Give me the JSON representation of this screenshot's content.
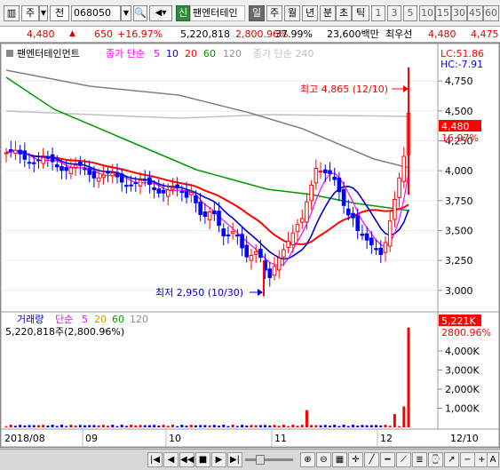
{
  "toolbar": {
    "market": "주",
    "range": "전",
    "code": "068050",
    "new_badge": "신",
    "stock_name": "팬엔터테인",
    "periods": [
      "일",
      "주",
      "월",
      "년",
      "분",
      "초",
      "틱"
    ],
    "selected_period": "일",
    "intervals": [
      "1",
      "3",
      "5",
      "10",
      "15",
      "30",
      "45",
      "60"
    ]
  },
  "price_row": {
    "price": "4,480",
    "change": "650",
    "change_pct": "+16.97%",
    "volume": "5,220,818",
    "volume_pct": "2,800.96%",
    "turnover": "37.99%",
    "amount": "23,600백만",
    "best_ask_label": "최우선",
    "ask": "4,480",
    "bid": "4,475"
  },
  "price_panel": {
    "legend_name": "팬엔터테인먼트",
    "legend_ma_label": "종가 단순",
    "ma_periods": [
      "5",
      "10",
      "20",
      "60",
      "120"
    ],
    "legend_ma240": "종가 단순 240",
    "lc": "LC:51.86",
    "hc": "HC:-7.91",
    "current_price": "4,480",
    "current_pct": "16.97%",
    "high_label": "최고 4,865 (12/10)",
    "low_label": "최저 2,950 (10/30)",
    "y_ticks": [
      "4,750",
      "4,500",
      "4,250",
      "4,000",
      "3,750",
      "3,500",
      "3,250",
      "3,000"
    ]
  },
  "volume_panel": {
    "legend_label": "거래량",
    "legend_ma_label": "단순",
    "ma_periods": [
      "5",
      "20",
      "60",
      "120"
    ],
    "value_text": "5,220,818주(2,800.96%)",
    "current_volume": "5,221K",
    "current_pct": "2800.96%",
    "y_ticks": [
      "4,000K",
      "3,000K",
      "2,000K",
      "1,000K"
    ]
  },
  "x_axis": {
    "labels": [
      "2018/08",
      "09",
      "10",
      "11",
      "12",
      "12/10"
    ]
  },
  "colors": {
    "up": "#ff0000",
    "down": "#0000ff",
    "ma5": "#ff00ff",
    "ma10": "#0000cc",
    "ma20": "#ff0000",
    "ma60": "#009900",
    "ma120": "#808080",
    "ma240": "#c0c0c0"
  },
  "chart_data": {
    "type": "candlestick",
    "price_ylim": [
      2850,
      4900
    ],
    "high": {
      "date": "12/10",
      "value": 4865
    },
    "low": {
      "date": "10/30",
      "value": 2950
    },
    "last_close": 4480,
    "last_volume": 5220818,
    "volume_ylim": [
      0,
      5300000
    ],
    "x_range": [
      "2018/08",
      "12/10"
    ]
  }
}
